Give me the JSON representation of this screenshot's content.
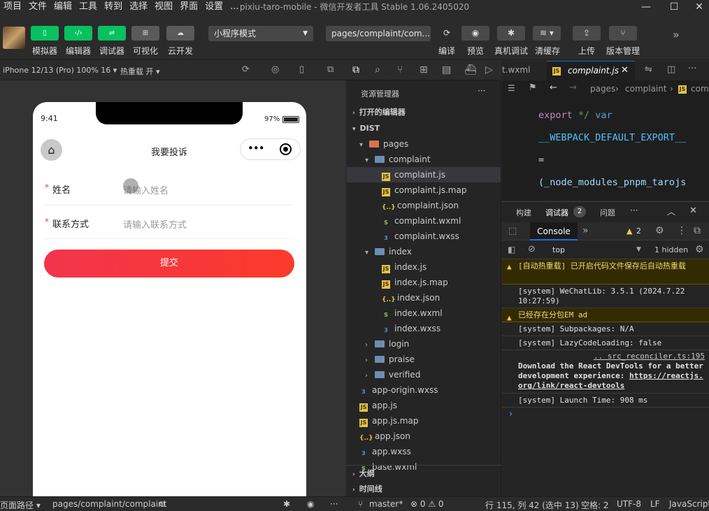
{
  "menubar": {
    "items": [
      "项目",
      "文件",
      "编辑",
      "工具",
      "转到",
      "选择",
      "视图",
      "界面",
      "设置",
      "..."
    ],
    "title": "pixiu-taro-mobile - 微信开发者工具 Stable 1.06.2405020"
  },
  "toolbar": {
    "left_buttons": [
      {
        "label": "模拟器",
        "icon": "phone-icon"
      },
      {
        "label": "编辑器",
        "icon": "code-icon"
      },
      {
        "label": "调试器",
        "icon": "debug-icon"
      },
      {
        "label": "可视化",
        "icon": "layout-icon"
      },
      {
        "label": "云开发",
        "icon": "cloud-icon"
      }
    ],
    "mode_select": "小程序模式",
    "page_select": "pages/complaint/com...",
    "right_buttons": [
      {
        "label": "编译",
        "icon": "refresh-icon"
      },
      {
        "label": "预览",
        "icon": "eye-icon"
      },
      {
        "label": "真机调试",
        "icon": "bug-icon"
      },
      {
        "label": "清缓存",
        "icon": "layers-icon"
      },
      {
        "label": "上传",
        "icon": "upload-icon"
      },
      {
        "label": "版本管理",
        "icon": "branch-icon"
      }
    ]
  },
  "simulator": {
    "device": "iPhone 12/13 (Pro) 100% 16 ▾",
    "hot_reload": "热重载 开 ▾",
    "time": "9:41",
    "battery": "97%",
    "nav_title": "我要投诉",
    "form": {
      "fields": [
        {
          "required": "*",
          "label": "姓名",
          "placeholder": "请输入姓名"
        },
        {
          "required": "*",
          "label": "联系方式",
          "placeholder": "请输入联系方式"
        }
      ],
      "submit": "提交"
    }
  },
  "explorer": {
    "title": "资源管理器",
    "open_editors": "打开的编辑器",
    "root": "DIST",
    "tree": [
      {
        "name": "pages",
        "type": "folder",
        "icon": "pages",
        "level": 1,
        "arrow": "▾"
      },
      {
        "name": "complaint",
        "type": "folder",
        "level": 2,
        "arrow": "▾"
      },
      {
        "name": "complaint.js",
        "type": "js",
        "level": 3,
        "selected": true
      },
      {
        "name": "complaint.js.map",
        "type": "js",
        "level": 3
      },
      {
        "name": "complaint.json",
        "type": "json",
        "level": 3
      },
      {
        "name": "complaint.wxml",
        "type": "wxml",
        "level": 3
      },
      {
        "name": "complaint.wxss",
        "type": "wxss",
        "level": 3
      },
      {
        "name": "index",
        "type": "folder",
        "level": 2,
        "arrow": "▾"
      },
      {
        "name": "index.js",
        "type": "js",
        "level": 3
      },
      {
        "name": "index.js.map",
        "type": "js",
        "level": 3
      },
      {
        "name": "index.json",
        "type": "json",
        "level": 3
      },
      {
        "name": "index.wxml",
        "type": "wxml",
        "level": 3
      },
      {
        "name": "index.wxss",
        "type": "wxss",
        "level": 3
      },
      {
        "name": "login",
        "type": "folder",
        "level": 2,
        "arrow": "›"
      },
      {
        "name": "praise",
        "type": "folder",
        "level": 2,
        "arrow": "›"
      },
      {
        "name": "verified",
        "type": "folder",
        "level": 2,
        "arrow": "›"
      },
      {
        "name": "app-origin.wxss",
        "type": "wxss",
        "level": 1
      },
      {
        "name": "app.js",
        "type": "js",
        "level": 1
      },
      {
        "name": "app.js.map",
        "type": "js",
        "level": 1
      },
      {
        "name": "app.json",
        "type": "json",
        "level": 1
      },
      {
        "name": "app.wxss",
        "type": "wxss",
        "level": 1
      },
      {
        "name": "base.wxml",
        "type": "wxml",
        "level": 1
      }
    ],
    "outline": "大纲",
    "timeline": "时间线"
  },
  "editor": {
    "tabs": [
      {
        "label": "t.wxml"
      },
      {
        "label": "complaint.js",
        "active": true
      }
    ],
    "breadcrumb": [
      "pages",
      "complaint",
      "com"
    ],
    "code": [
      "export */ var",
      "__WEBPACK_DEFAULT_EXPORT__",
      " =",
      "(_node_modules_pnpm_tarojs"
    ]
  },
  "devtools": {
    "tabs": [
      "构建",
      "调试器",
      "问题"
    ],
    "debugger_count": "2",
    "console_tab": "Console",
    "warn_count": "2",
    "context": "top",
    "hidden": "1 hidden",
    "logs": [
      {
        "type": "warn",
        "text": "[自动热重载] 已开启代码文件保存后自动热重载"
      },
      {
        "type": "info",
        "text": "[system] WeChatLib: 3.5.1 (2024.7.22 10:27:59)"
      },
      {
        "type": "warn",
        "text": "已经存在分包EM ad"
      },
      {
        "type": "info",
        "text": "[system] Subpackages: N/A"
      },
      {
        "type": "info",
        "text": "[system] LazyCodeLoading: false"
      },
      {
        "type": "info",
        "source": ".. src_reconciler.ts:195",
        "text": "Download the React DevTools for a better development experience: ",
        "link": "https://reactjs.org/link/react-devtools"
      },
      {
        "type": "info",
        "text": "[system] Launch Time: 908 ms"
      }
    ],
    "prompt": "›"
  },
  "statusbar": {
    "page_path_label": "页面路径 ▾",
    "page_path": "pages/complaint/complaint",
    "branch": "master*",
    "errors": "⊗ 0 ⚠ 0",
    "cursor": "行 115, 列 42 (选中 13)",
    "spaces": "空格: 2",
    "encoding": "UTF-8",
    "eol": "LF",
    "language": "JavaScript"
  }
}
